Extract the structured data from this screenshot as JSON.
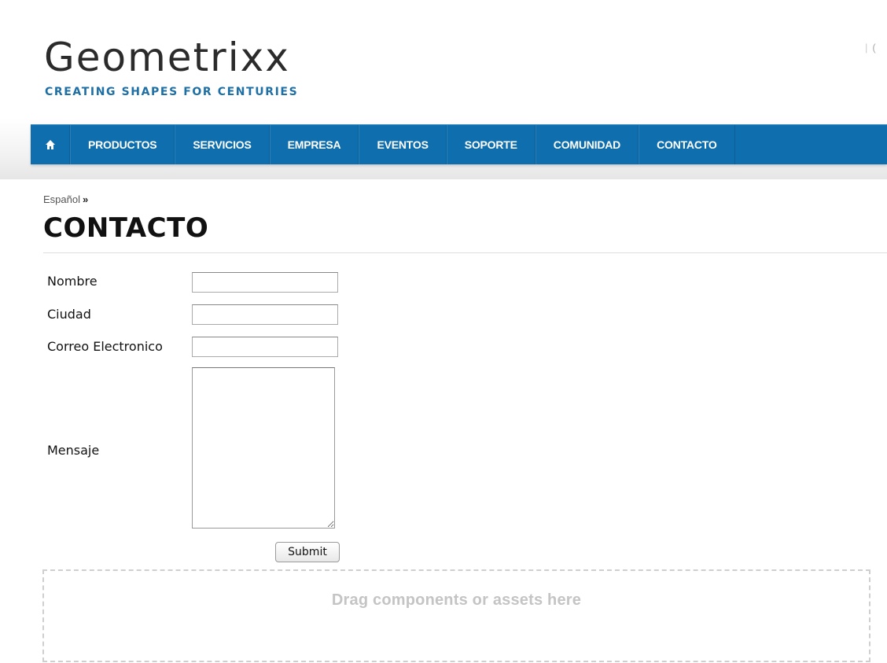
{
  "header": {
    "logo_title": "Geometrixx",
    "logo_tagline": "CREATING SHAPES FOR CENTURIES",
    "top_right_link": "("
  },
  "nav": {
    "home_icon": "home-icon",
    "items": [
      {
        "label": "PRODUCTOS"
      },
      {
        "label": "SERVICIOS"
      },
      {
        "label": "EMPRESA"
      },
      {
        "label": "EVENTOS"
      },
      {
        "label": "SOPORTE"
      },
      {
        "label": "COMUNIDAD"
      },
      {
        "label": "CONTACTO"
      }
    ]
  },
  "breadcrumb": {
    "language": "Español",
    "separator": "»"
  },
  "page": {
    "title": "CONTACTO"
  },
  "form": {
    "name_label": "Nombre",
    "name_value": "",
    "city_label": "Ciudad",
    "city_value": "",
    "email_label": "Correo Electronico",
    "email_value": "",
    "message_label": "Mensaje",
    "message_value": "",
    "submit_label": "Submit"
  },
  "drop_zone": {
    "label": "Drag components or assets here"
  },
  "colors": {
    "nav_background": "#0f6fae",
    "tagline": "#1d6fa5"
  }
}
